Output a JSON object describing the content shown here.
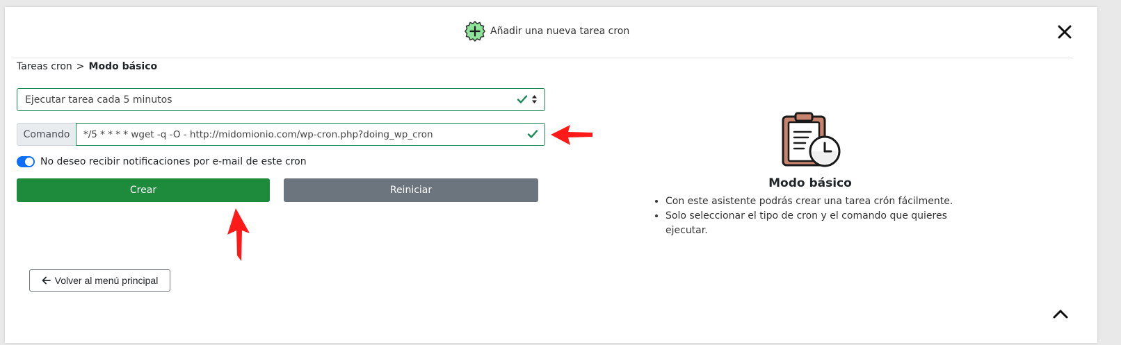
{
  "header": {
    "title": "Añadir una nueva tarea cron",
    "icon": "plus-badge-icon",
    "close_icon": "close-icon",
    "accent_color": "#8fe39a"
  },
  "breadcrumb": {
    "parent": "Tareas cron",
    "separator": ">",
    "current": "Modo básico"
  },
  "form": {
    "schedule_select": {
      "selected": "Ejecutar tarea cada 5 minutos",
      "status": "valid"
    },
    "command": {
      "label": "Comando",
      "value": "*/5 * * * * wget -q -O - http://midomionio.com/wp-cron.php?doing_wp_cron",
      "status": "valid"
    },
    "notifications_toggle": {
      "label": "No deseo recibir notificaciones por e-mail de este cron",
      "checked": true
    },
    "create_label": "Crear",
    "reset_label": "Reiniciar"
  },
  "back_button": {
    "label": "Volver al menú principal",
    "icon": "arrow-left-icon"
  },
  "info": {
    "icon": "clipboard-clock-icon",
    "title": "Modo básico",
    "bullets": [
      "Con este asistente podrás crear una tarea crón fácilmente.",
      "Solo seleccionar el tipo de cron y el comando que quieres ejecutar."
    ]
  },
  "colors": {
    "success": "#198754",
    "create_button": "#1e8a3c",
    "reset_button": "#6c757d",
    "toggle": "#0d6efd",
    "annotation_arrow": "#ff0000"
  }
}
